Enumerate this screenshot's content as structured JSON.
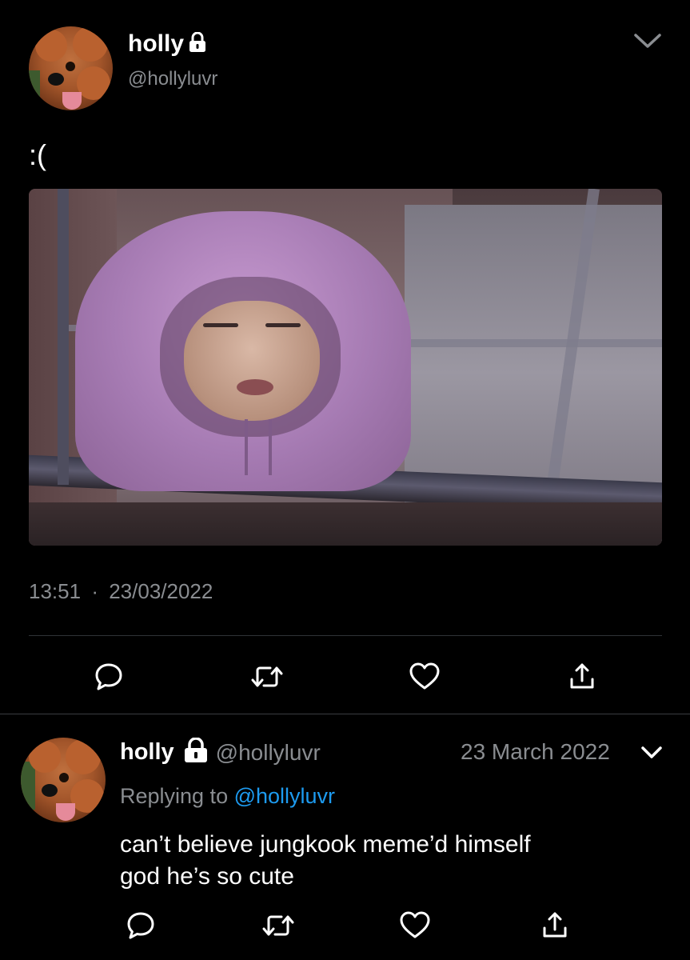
{
  "tweet": {
    "author_name": "holly",
    "author_handle": "@hollyluvr",
    "text": ":(",
    "time": "13:51",
    "separator": "·",
    "date": "23/03/2022"
  },
  "reply": {
    "author_name": "holly",
    "author_handle": "@hollyluvr",
    "date": "23 March 2022",
    "replying_prefix": "Replying to",
    "replying_handle": "@hollyluvr",
    "text_line1": "can’t believe jungkook meme’d himself",
    "text_line2": "god he’s so cute"
  },
  "icons": {
    "lock": "lock-icon",
    "chevron": "chevron-down-icon",
    "reply": "reply-icon",
    "retweet": "retweet-icon",
    "like": "heart-icon",
    "share": "share-icon"
  },
  "colors": {
    "background": "#000000",
    "text": "#ffffff",
    "secondary_text": "#8a8d91",
    "link": "#1d9bf0",
    "divider": "#2f3336"
  }
}
